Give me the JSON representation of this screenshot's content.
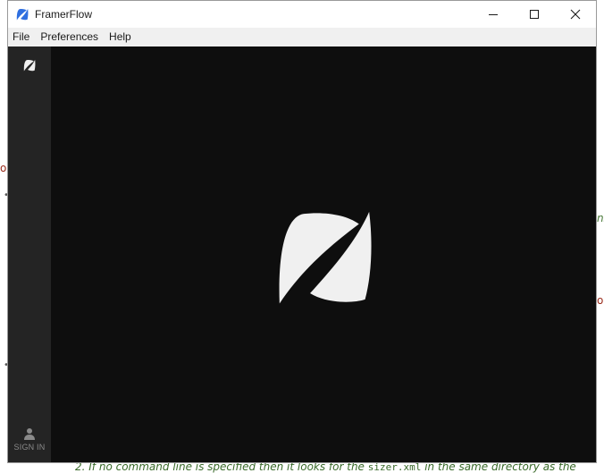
{
  "window": {
    "title": "FramerFlow",
    "minimize_icon": "minimize-icon",
    "maximize_icon": "maximize-icon",
    "close_icon": "close-icon"
  },
  "menubar": {
    "items": [
      "File",
      "Preferences",
      "Help"
    ]
  },
  "sidebar": {
    "logo_icon": "framerflow-logo-icon",
    "signin_label": "SIGN IN",
    "signin_icon": "user-icon"
  },
  "main": {
    "splash_icon": "framerflow-logo-icon"
  },
  "background": {
    "frag_left": "o",
    "frag_right_1": "ns",
    "frag_right_2": "oa",
    "bottom_line_before": "2. If no command line is specified then it looks for the ",
    "bottom_line_code": "sizer.xml",
    "bottom_line_after": " in the same directory as the"
  },
  "colors": {
    "window_bg": "#0e0e0e",
    "sidebar_bg": "#242424",
    "logo_fill": "#f0f0f0",
    "app_icon_blue": "#2f6fe0"
  }
}
